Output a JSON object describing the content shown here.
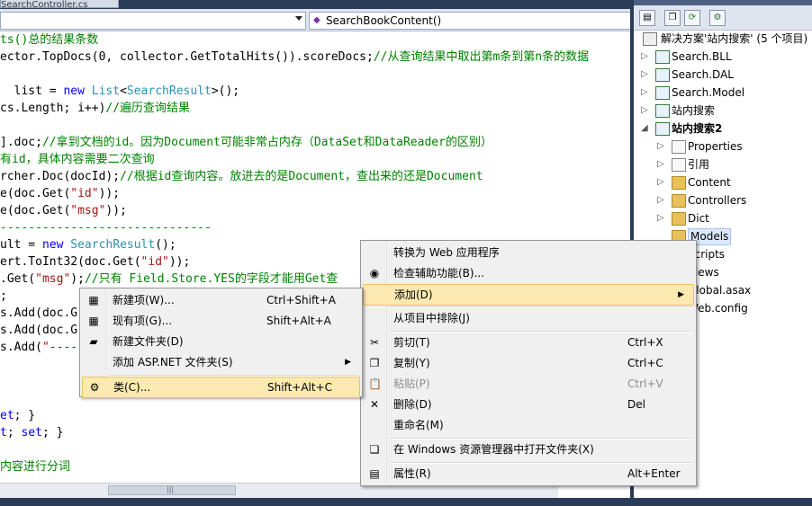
{
  "editor": {
    "doc_tab": "SearchController.cs",
    "type_combo": "",
    "member_combo": "SearchBookContent()",
    "lines": [
      {
        "parts": [
          {
            "c": "g",
            "t": "ts()总的结果条数"
          }
        ]
      },
      {
        "parts": [
          {
            "c": "",
            "t": "ector.TopDocs(0, collector.GetTotalHits()).scoreDocs;"
          },
          {
            "c": "g",
            "t": "//从查询结果中取出第m条到第n条的数据"
          }
        ]
      },
      {
        "parts": [
          {
            "c": "",
            "t": " "
          }
        ]
      },
      {
        "parts": [
          {
            "c": "",
            "t": "  list = "
          },
          {
            "c": "k",
            "t": "new"
          },
          {
            "c": "",
            "t": " "
          },
          {
            "c": "t",
            "t": "List"
          },
          {
            "c": "",
            "t": "<"
          },
          {
            "c": "t",
            "t": "SearchResult"
          },
          {
            "c": "",
            "t": ">();"
          }
        ]
      },
      {
        "parts": [
          {
            "c": "",
            "t": "cs.Length; i++)"
          },
          {
            "c": "g",
            "t": "//遍历查询结果"
          }
        ]
      },
      {
        "parts": [
          {
            "c": "",
            "t": " "
          }
        ]
      },
      {
        "parts": [
          {
            "c": "",
            "t": "].doc;"
          },
          {
            "c": "g",
            "t": "//拿到文档的id。因为Document可能非常占内存（DataSet和DataReader的区别）"
          }
        ]
      },
      {
        "parts": [
          {
            "c": "g",
            "t": "有id，具体内容需要二次查询"
          }
        ]
      },
      {
        "parts": [
          {
            "c": "",
            "t": "rcher.Doc(docId);"
          },
          {
            "c": "g",
            "t": "//根据id查询内容。放进去的是Document，查出来的还是Document"
          }
        ]
      },
      {
        "parts": [
          {
            "c": "",
            "t": "e(doc.Get("
          },
          {
            "c": "s",
            "t": "\"id\""
          },
          {
            "c": "",
            "t": "));"
          }
        ]
      },
      {
        "parts": [
          {
            "c": "",
            "t": "e(doc.Get("
          },
          {
            "c": "s",
            "t": "\"msg\""
          },
          {
            "c": "",
            "t": "));"
          }
        ]
      },
      {
        "parts": [
          {
            "c": "g",
            "t": "------------------------------"
          }
        ]
      },
      {
        "parts": [
          {
            "c": "",
            "t": "ult = "
          },
          {
            "c": "k",
            "t": "new"
          },
          {
            "c": "",
            "t": " "
          },
          {
            "c": "t",
            "t": "SearchResult"
          },
          {
            "c": "",
            "t": "();"
          }
        ]
      },
      {
        "parts": [
          {
            "c": "",
            "t": "ert.ToInt32(doc.Get("
          },
          {
            "c": "s",
            "t": "\"id\""
          },
          {
            "c": "",
            "t": "));"
          }
        ]
      },
      {
        "parts": [
          {
            "c": "",
            "t": ".Get("
          },
          {
            "c": "s",
            "t": "\"msg\""
          },
          {
            "c": "",
            "t": ");"
          },
          {
            "c": "g",
            "t": "//只有 Field.Store.YES的字段才能用Get查"
          }
        ]
      },
      {
        "parts": [
          {
            "c": "",
            "t": ";"
          }
        ]
      },
      {
        "parts": [
          {
            "c": "",
            "t": "s.Add(doc.G"
          }
        ]
      },
      {
        "parts": [
          {
            "c": "",
            "t": "s.Add(doc.G"
          }
        ]
      },
      {
        "parts": [
          {
            "c": "",
            "t": "s.Add("
          },
          {
            "c": "s",
            "t": "\"----"
          }
        ]
      },
      {
        "parts": [
          {
            "c": "",
            "t": " "
          }
        ]
      },
      {
        "parts": [
          {
            "c": "",
            "t": " "
          }
        ]
      },
      {
        "parts": [
          {
            "c": "",
            "t": " "
          }
        ]
      },
      {
        "parts": [
          {
            "c": "k",
            "t": "et"
          },
          {
            "c": "",
            "t": "; }"
          }
        ]
      },
      {
        "parts": [
          {
            "c": "k",
            "t": "t"
          },
          {
            "c": "",
            "t": "; "
          },
          {
            "c": "k",
            "t": "set"
          },
          {
            "c": "",
            "t": "; }"
          }
        ]
      },
      {
        "parts": [
          {
            "c": "",
            "t": " "
          }
        ]
      },
      {
        "parts": [
          {
            "c": "g",
            "t": "内容进行分词"
          }
        ]
      }
    ]
  },
  "solution_explorer": {
    "toolbar_icons": [
      "properties-icon",
      "show-all-files-icon",
      "refresh-icon",
      "class-diagram-icon"
    ],
    "items": [
      {
        "label": "解决方案'站内搜索' (5 个项目)",
        "icon": "solution",
        "exp": "",
        "indent": 0,
        "bold": false
      },
      {
        "label": "Search.BLL",
        "icon": "proj",
        "exp": "▷",
        "indent": 1,
        "bold": false
      },
      {
        "label": "Search.DAL",
        "icon": "proj",
        "exp": "▷",
        "indent": 1,
        "bold": false
      },
      {
        "label": "Search.Model",
        "icon": "proj",
        "exp": "▷",
        "indent": 1,
        "bold": false
      },
      {
        "label": "站内搜索",
        "icon": "proj",
        "exp": "▷",
        "indent": 1,
        "bold": false
      },
      {
        "label": "站内搜索2",
        "icon": "proj",
        "exp": "◢",
        "indent": 1,
        "bold": true
      },
      {
        "label": "Properties",
        "icon": "cfg",
        "exp": "▷",
        "indent": 2,
        "bold": false
      },
      {
        "label": "引用",
        "icon": "cfg",
        "exp": "▷",
        "indent": 2,
        "bold": false
      },
      {
        "label": "Content",
        "icon": "fold",
        "exp": "▷",
        "indent": 2,
        "bold": false
      },
      {
        "label": "Controllers",
        "icon": "fold",
        "exp": "▷",
        "indent": 2,
        "bold": false
      },
      {
        "label": "Dict",
        "icon": "fold",
        "exp": "▷",
        "indent": 2,
        "bold": false
      },
      {
        "label": "Models",
        "icon": "fold",
        "exp": "",
        "indent": 2,
        "bold": false,
        "selected": true
      },
      {
        "label": "Scripts",
        "icon": "fold",
        "exp": "",
        "indent": 2,
        "bold": false
      },
      {
        "label": "Views",
        "icon": "fold",
        "exp": "",
        "indent": 2,
        "bold": false
      },
      {
        "label": "Global.asax",
        "icon": "cfg",
        "exp": "",
        "indent": 2,
        "bold": false
      },
      {
        "label": "Web.config",
        "icon": "cfg",
        "exp": "",
        "indent": 2,
        "bold": false
      }
    ]
  },
  "context_menu": {
    "items": [
      {
        "label": "转换为 Web 应用程序",
        "shortcut": "",
        "icon": ""
      },
      {
        "label": "检查辅助功能(B)...",
        "shortcut": "",
        "icon": "accessibility-icon"
      },
      {
        "label": "添加(D)",
        "shortcut": "",
        "icon": "",
        "submenu": true,
        "highlight": true
      },
      {
        "sep": true
      },
      {
        "label": "从项目中排除(J)",
        "shortcut": "",
        "icon": ""
      },
      {
        "sep": true
      },
      {
        "label": "剪切(T)",
        "shortcut": "Ctrl+X",
        "icon": "cut-icon"
      },
      {
        "label": "复制(Y)",
        "shortcut": "Ctrl+C",
        "icon": "copy-icon"
      },
      {
        "label": "粘贴(P)",
        "shortcut": "Ctrl+V",
        "icon": "paste-icon",
        "disabled": true
      },
      {
        "label": "删除(D)",
        "shortcut": "Del",
        "icon": "delete-icon"
      },
      {
        "label": "重命名(M)",
        "shortcut": "",
        "icon": ""
      },
      {
        "sep": true
      },
      {
        "label": "在 Windows 资源管理器中打开文件夹(X)",
        "shortcut": "",
        "icon": "open-folder-icon"
      },
      {
        "sep": true
      },
      {
        "label": "属性(R)",
        "shortcut": "Alt+Enter",
        "icon": "properties-icon"
      }
    ]
  },
  "submenu": {
    "items": [
      {
        "label": "新建项(W)...",
        "shortcut": "Ctrl+Shift+A",
        "icon": "new-item-icon"
      },
      {
        "label": "现有项(G)...",
        "shortcut": "Shift+Alt+A",
        "icon": "existing-item-icon"
      },
      {
        "label": "新建文件夹(D)",
        "shortcut": "",
        "icon": "new-folder-icon"
      },
      {
        "label": "添加 ASP.NET 文件夹(S)",
        "shortcut": "",
        "icon": "",
        "submenu": true
      },
      {
        "sep": true
      },
      {
        "label": "类(C)...",
        "shortcut": "Shift+Alt+C",
        "icon": "class-icon",
        "highlight": true
      }
    ]
  }
}
